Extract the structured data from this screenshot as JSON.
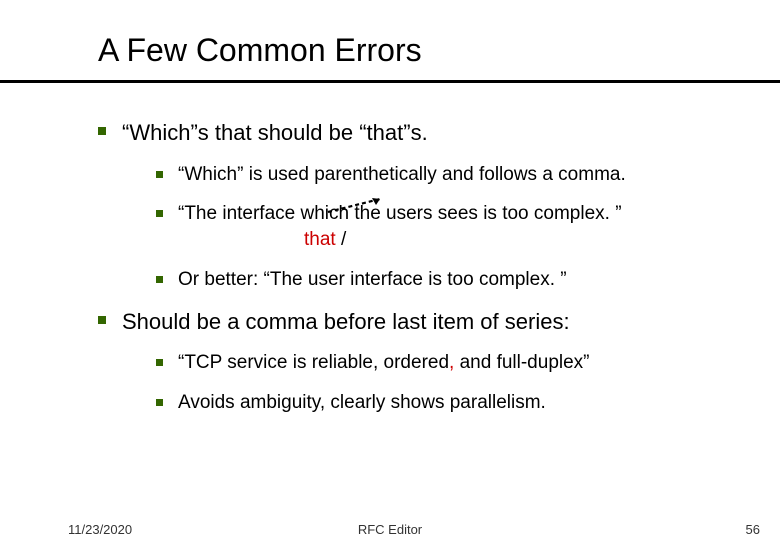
{
  "title": "A Few Common Errors",
  "bullets": [
    {
      "text": "“Which”s that should be “that”s.",
      "sub": [
        {
          "text": "“Which” is used parenthetically and follows a comma."
        },
        {
          "text": "“The interface which the users sees is too complex. ”",
          "correction_prefix": "that",
          "correction_suffix": " /"
        },
        {
          "text": "Or better: “The user interface is too complex. ”"
        }
      ]
    },
    {
      "text": "Should be a comma before last item of series:",
      "sub": [
        {
          "pre": "“TCP service is reliable, ordered",
          "comma": ",",
          "post": " and full-duplex”"
        },
        {
          "text": "Avoids ambiguity, clearly shows parallelism."
        }
      ]
    }
  ],
  "footer": {
    "date": "11/23/2020",
    "center": "RFC Editor",
    "page": "56"
  }
}
